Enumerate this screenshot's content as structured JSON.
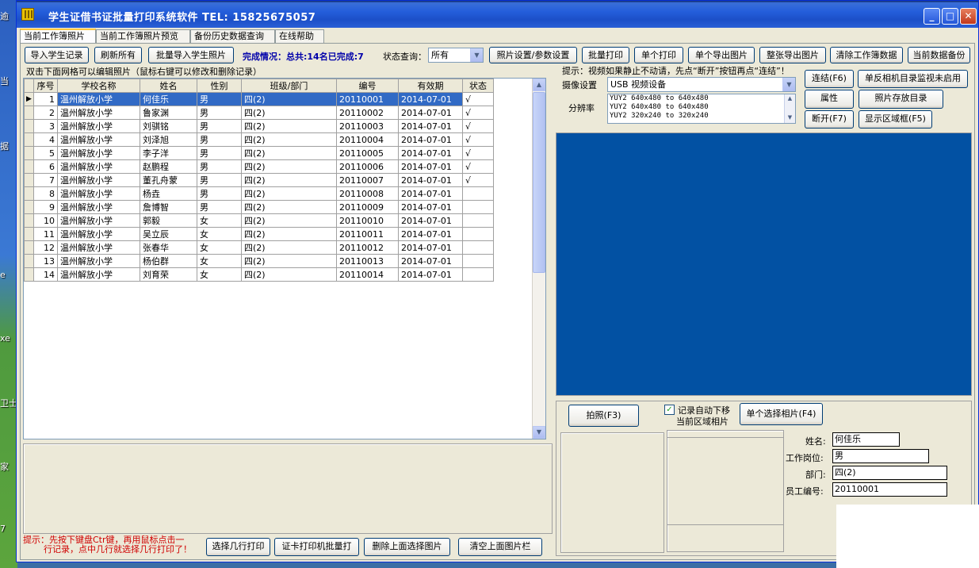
{
  "desktop": {
    "left_labels": [
      "逾",
      "当",
      "据",
      "e",
      "xe",
      "卫士",
      "家",
      "7"
    ]
  },
  "window": {
    "title": "学生证借书证批量打印系统软件  TEL: 15825675057"
  },
  "tabs": [
    "当前工作簿照片",
    "当前工作簿照片预览",
    "备份历史数据查询",
    "在线帮助"
  ],
  "toolbar": {
    "import_students": "导入学生记录",
    "refresh_all": "刷新所有",
    "batch_import_photos": "批量导入学生照片",
    "completion_label": "完成情况：",
    "completion_text": "总共:14名已完成:7",
    "status_query_label": "状态查询：",
    "status_query_value": "所有",
    "photo_settings": "照片设置/参数设置",
    "batch_print": "批量打印",
    "single_print": "单个打印",
    "single_export": "单个导出图片",
    "page_export": "整张导出图片",
    "clear_workbook": "清除工作簿数据",
    "backup_current": "当前数据备份"
  },
  "grid": {
    "hint": "双击下面网格可以编辑照片（鼠标右键可以修改和删除记录）",
    "columns": [
      "序号",
      "学校名称",
      "姓名",
      "性别",
      "班级/部门",
      "编号",
      "有效期",
      "状态"
    ],
    "rows": [
      [
        "1",
        "温州解放小学",
        "何佳乐",
        "男",
        "四(2)",
        "20110001",
        "2014-07-01",
        "√"
      ],
      [
        "2",
        "温州解放小学",
        "鲁家渊",
        "男",
        "四(2)",
        "20110002",
        "2014-07-01",
        "√"
      ],
      [
        "3",
        "温州解放小学",
        "刘骐铭",
        "男",
        "四(2)",
        "20110003",
        "2014-07-01",
        "√"
      ],
      [
        "4",
        "温州解放小学",
        "刘泽旭",
        "男",
        "四(2)",
        "20110004",
        "2014-07-01",
        "√"
      ],
      [
        "5",
        "温州解放小学",
        "李子洋",
        "男",
        "四(2)",
        "20110005",
        "2014-07-01",
        "√"
      ],
      [
        "6",
        "温州解放小学",
        "赵鹏程",
        "男",
        "四(2)",
        "20110006",
        "2014-07-01",
        "√"
      ],
      [
        "7",
        "温州解放小学",
        "董孔舟蒙",
        "男",
        "四(2)",
        "20110007",
        "2014-07-01",
        "√"
      ],
      [
        "8",
        "温州解放小学",
        "杨垚",
        "男",
        "四(2)",
        "20110008",
        "2014-07-01",
        ""
      ],
      [
        "9",
        "温州解放小学",
        "詹博智",
        "男",
        "四(2)",
        "20110009",
        "2014-07-01",
        ""
      ],
      [
        "10",
        "温州解放小学",
        "郭毅",
        "女",
        "四(2)",
        "20110010",
        "2014-07-01",
        ""
      ],
      [
        "11",
        "温州解放小学",
        "吴立辰",
        "女",
        "四(2)",
        "20110011",
        "2014-07-01",
        ""
      ],
      [
        "12",
        "温州解放小学",
        "张春华",
        "女",
        "四(2)",
        "20110012",
        "2014-07-01",
        ""
      ],
      [
        "13",
        "温州解放小学",
        "杨伯群",
        "女",
        "四(2)",
        "20110013",
        "2014-07-01",
        ""
      ],
      [
        "14",
        "温州解放小学",
        "刘育荣",
        "女",
        "四(2)",
        "20110014",
        "2014-07-01",
        ""
      ]
    ]
  },
  "camera": {
    "tip": "提示：视频如果静止不动请，先点“断开”按钮再点“连结”！",
    "device_label": "摄像设置",
    "device_value": "USB 视频设备",
    "resolution_label": "分辨率",
    "resolutions": [
      "YUY2  640x480  to  640x480",
      "YUY2  640x480  to  640x480",
      "YUY2  320x240  to  320x240"
    ],
    "connect": "连结(F6)",
    "monitor": "单反相机目录监视未启用",
    "properties": "属性",
    "photo_dir": "照片存放目录",
    "disconnect": "断开(F7)",
    "show_frame": "显示区域框(F5)"
  },
  "capture": {
    "take_photo": "拍照(F3)",
    "auto_next": "记录自动下移",
    "current_photo": "当前区域相片",
    "select_photo": "单个选择相片(F4)"
  },
  "info": {
    "name_label": "姓名:",
    "name_value": "何佳乐",
    "post_label": "工作岗位:",
    "post_value": "男",
    "dept_label": "部门:",
    "dept_value": "四(2)",
    "id_label": "员工编号:",
    "id_value": "20110001"
  },
  "bottom": {
    "tip_line1": "提示：先按下键盘Ctr键，再用鼠标点击一",
    "tip_line2": "行记录，点中几行就选择几行打印了！",
    "select_rows_print": "选择几行打印",
    "card_printer": "证卡打印机批量打",
    "delete_photos": "删除上面选择图片",
    "clear_photos": "清空上面图片栏"
  },
  "colors": {
    "title_bar": "#245edb",
    "video_bg": "#0251a3",
    "selection": "#316ac5",
    "highlight_text": "#0000aa",
    "tip_red": "#d00000"
  }
}
